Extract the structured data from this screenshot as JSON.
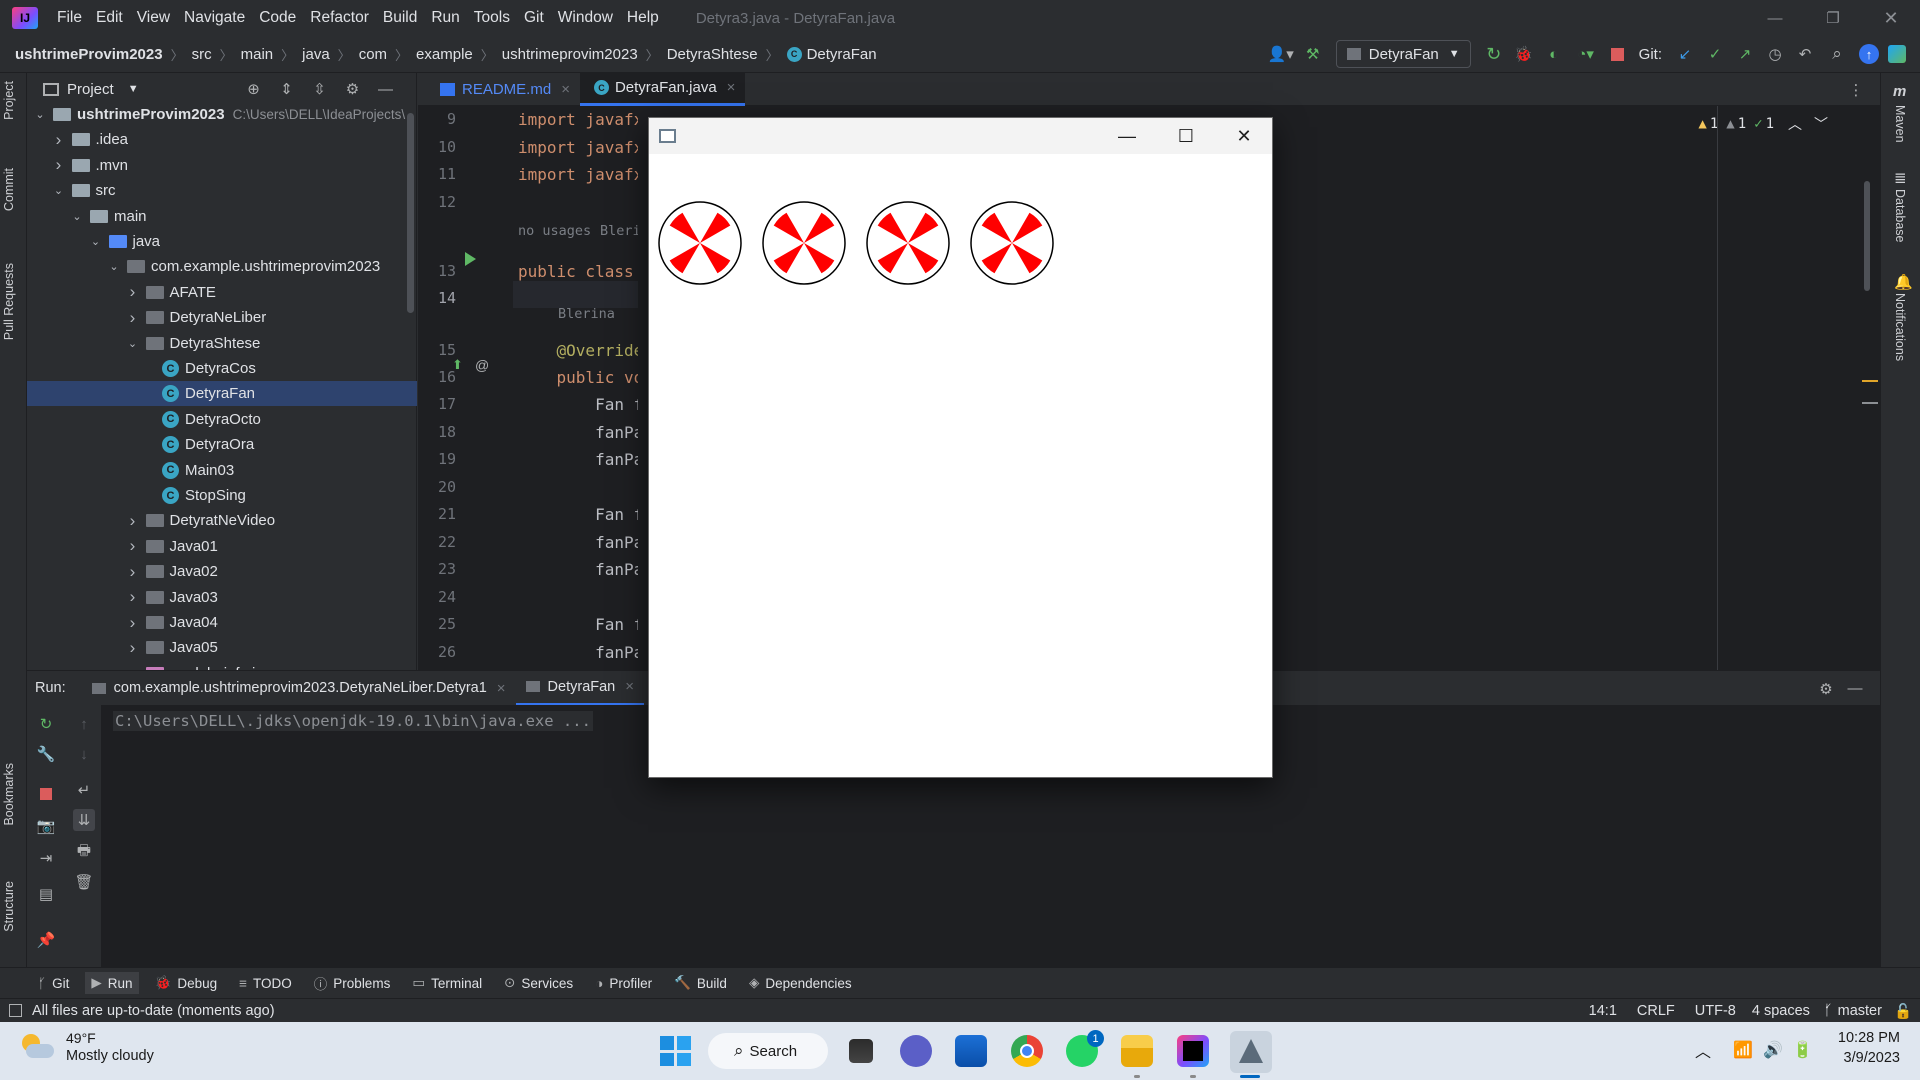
{
  "window": {
    "menu": [
      "File",
      "Edit",
      "View",
      "Navigate",
      "Code",
      "Refactor",
      "Build",
      "Run",
      "Tools",
      "Git",
      "Window",
      "Help"
    ],
    "title": "Detyra3.java - DetyraFan.java"
  },
  "breadcrumb": [
    "ushtrimeProvim2023",
    "src",
    "main",
    "java",
    "com",
    "example",
    "ushtrimeprovim2023",
    "DetyraShtese",
    "DetyraFan"
  ],
  "nav_toolbar": {
    "run_config": "DetyraFan",
    "git_label": "Git:"
  },
  "left_stripe": [
    "Project",
    "Commit",
    "Pull Requests",
    "Bookmarks",
    "Structure"
  ],
  "right_stripe": [
    "Maven",
    "Database",
    "Notifications"
  ],
  "project_panel": {
    "title": "Project",
    "tree": [
      {
        "label": "ushtrimeProvim2023",
        "hint": "C:\\Users\\DELL\\IdeaProjects\\",
        "kind": "module",
        "arrow": "down",
        "depth": 0
      },
      {
        "label": ".idea",
        "kind": "folder",
        "arrow": "right",
        "depth": 1
      },
      {
        "label": ".mvn",
        "kind": "folder",
        "arrow": "right",
        "depth": 1
      },
      {
        "label": "src",
        "kind": "folder",
        "arrow": "down",
        "depth": 1
      },
      {
        "label": "main",
        "kind": "folder",
        "arrow": "down",
        "depth": 2
      },
      {
        "label": "java",
        "kind": "folder-blue",
        "arrow": "down",
        "depth": 3
      },
      {
        "label": "com.example.ushtrimeprovim2023",
        "kind": "package",
        "arrow": "down",
        "depth": 4
      },
      {
        "label": "AFATE",
        "kind": "package",
        "arrow": "right",
        "depth": 5
      },
      {
        "label": "DetyraNeLiber",
        "kind": "package",
        "arrow": "right",
        "depth": 5
      },
      {
        "label": "DetyraShtese",
        "kind": "package",
        "arrow": "down",
        "depth": 5
      },
      {
        "label": "DetyraCos",
        "kind": "class",
        "depth": 6
      },
      {
        "label": "DetyraFan",
        "kind": "class",
        "depth": 6,
        "selected": true
      },
      {
        "label": "DetyraOcto",
        "kind": "class",
        "depth": 6
      },
      {
        "label": "DetyraOra",
        "kind": "class",
        "depth": 6
      },
      {
        "label": "Main03",
        "kind": "class",
        "depth": 6
      },
      {
        "label": "StopSing",
        "kind": "class",
        "depth": 6
      },
      {
        "label": "DetyratNeVideo",
        "kind": "package",
        "arrow": "right",
        "depth": 5
      },
      {
        "label": "Java01",
        "kind": "package",
        "arrow": "right",
        "depth": 5
      },
      {
        "label": "Java02",
        "kind": "package",
        "arrow": "right",
        "depth": 5
      },
      {
        "label": "Java03",
        "kind": "package",
        "arrow": "right",
        "depth": 5
      },
      {
        "label": "Java04",
        "kind": "package",
        "arrow": "right",
        "depth": 5
      },
      {
        "label": "Java05",
        "kind": "package",
        "arrow": "right",
        "depth": 5
      },
      {
        "label": "module-info.java",
        "kind": "file",
        "depth": 5
      }
    ]
  },
  "editor": {
    "tabs": [
      {
        "label": "README.md",
        "active": false
      },
      {
        "label": "DetyraFan.java",
        "active": true
      }
    ],
    "inspections": {
      "warn1": "1",
      "warn2": "1",
      "ok": "1"
    },
    "lines": [
      {
        "n": "9",
        "code": "import javafx"
      },
      {
        "n": "10",
        "code": "import javafx"
      },
      {
        "n": "11",
        "code": "import javafx"
      },
      {
        "n": "12",
        "code": ""
      },
      {
        "n": "13",
        "code": "public class "
      },
      {
        "n": "14",
        "code": ""
      },
      {
        "n": "15",
        "code": "    @Override"
      },
      {
        "n": "16",
        "code": "    public vo"
      },
      {
        "n": "17",
        "code": "        Fan f"
      },
      {
        "n": "18",
        "code": "        fanPa"
      },
      {
        "n": "19",
        "code": "        fanPa"
      },
      {
        "n": "20",
        "code": ""
      },
      {
        "n": "21",
        "code": "        Fan f"
      },
      {
        "n": "22",
        "code": "        fanPa"
      },
      {
        "n": "23",
        "code": "        fanPa"
      },
      {
        "n": "24",
        "code": ""
      },
      {
        "n": "25",
        "code": "        Fan f"
      },
      {
        "n": "26",
        "code": "        fanPa"
      },
      {
        "n": "27",
        "code": "        fanPa"
      }
    ],
    "hint_usages": "no usages",
    "hint_author1": "Bleri",
    "hint_author2": "Blerina"
  },
  "run_panel": {
    "label": "Run:",
    "tabs": [
      "com.example.ushtrimeprovim2023.DetyraNeLiber.Detyra1",
      "DetyraFan"
    ],
    "console_line": "C:\\Users\\DELL\\.jdks\\openjdk-19.0.1\\bin\\java.exe ..."
  },
  "tool_windows": [
    "Git",
    "Run",
    "Debug",
    "TODO",
    "Problems",
    "Terminal",
    "Services",
    "Profiler",
    "Build",
    "Dependencies"
  ],
  "status": {
    "message": "All files are up-to-date (moments ago)",
    "position": "14:1",
    "line_sep": "CRLF",
    "encoding": "UTF-8",
    "indent": "4 spaces",
    "branch": "master"
  },
  "fx_window": {
    "fans": 4,
    "fan_color": "#ff0000",
    "blades_per_fan": 4
  },
  "taskbar": {
    "weather_temp": "49°F",
    "weather_desc": "Mostly cloudy",
    "search_label": "Search",
    "time": "10:28 PM",
    "date": "3/9/2023",
    "whatsapp_badge": "1"
  }
}
